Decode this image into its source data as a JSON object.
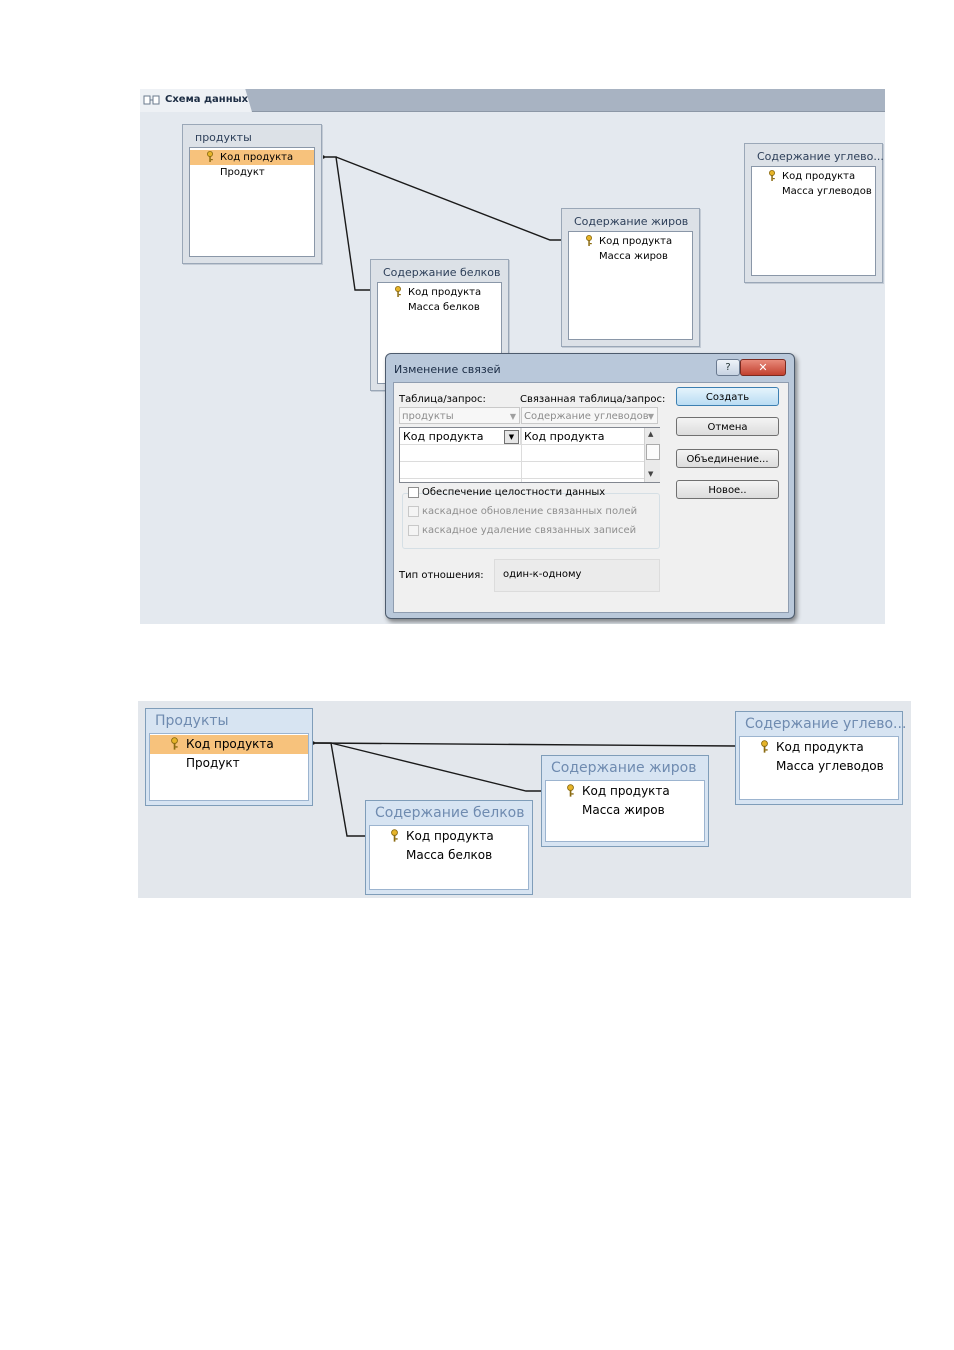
{
  "screenshot1": {
    "tab": {
      "label": "Схема данных"
    },
    "tables": {
      "products": {
        "title": "продукты",
        "fields": [
          "Код продукта",
          "Продукт"
        ]
      },
      "proteins": {
        "title": "Содержание белков",
        "fields": [
          "Код продукта",
          "Масса белков"
        ]
      },
      "fats": {
        "title": "Содержание жиров",
        "fields": [
          "Код продукта",
          "Масса жиров"
        ]
      },
      "carbs": {
        "title": "Содержание углево...",
        "fields": [
          "Код продукта",
          "Масса углеводов"
        ]
      }
    },
    "dialog": {
      "title": "Изменение связей",
      "help": "?",
      "close": "✕",
      "table_label": "Таблица/запрос:",
      "related_label": "Связанная таблица/запрос:",
      "table_value": "продукты",
      "related_value": "Содержание углеводов",
      "grid": {
        "left": "Код продукта",
        "right": "Код продукта"
      },
      "buttons": {
        "create": "Создать",
        "cancel": "Отмена",
        "join": "Объединение...",
        "new": "Новое.."
      },
      "integrity": "Обеспечение целостности данных",
      "cascade_update": "каскадное обновление связанных полей",
      "cascade_delete": "каскадное удаление связанных записей",
      "relation_label": "Тип отношения:",
      "relation_value": "один-к-одному"
    }
  },
  "screenshot2": {
    "tables": {
      "products": {
        "title": "Продукты",
        "fields": [
          "Код продукта",
          "Продукт"
        ]
      },
      "proteins": {
        "title": "Содержание белков",
        "fields": [
          "Код продукта",
          "Масса белков"
        ]
      },
      "fats": {
        "title": "Содержание жиров",
        "fields": [
          "Код продукта",
          "Масса жиров"
        ]
      },
      "carbs": {
        "title": "Содержание углево...",
        "fields": [
          "Код продукта",
          "Масса углеводов"
        ]
      }
    }
  },
  "colors": {
    "selected_field": "#f7c27c",
    "canvas": "#e4e9ef",
    "default_button": "#b9dcf3"
  }
}
